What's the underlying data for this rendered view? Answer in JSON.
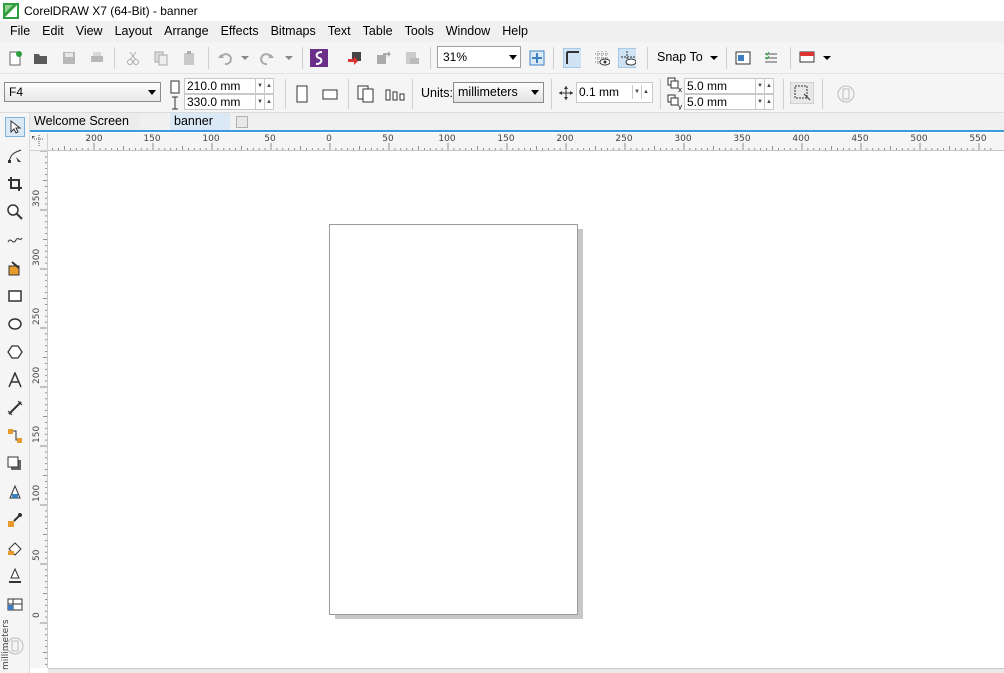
{
  "window": {
    "title": "CorelDRAW X7 (64-Bit) - banner"
  },
  "menu": [
    "File",
    "Edit",
    "View",
    "Layout",
    "Arrange",
    "Effects",
    "Bitmaps",
    "Text",
    "Table",
    "Tools",
    "Window",
    "Help"
  ],
  "toolbar": {
    "zoom_value": "31%",
    "snap_to_label": "Snap To"
  },
  "property_bar": {
    "page_size": "F4",
    "width": "210.0 mm",
    "height": "330.0 mm",
    "units_label": "Units:",
    "units_value": "millimeters",
    "nudge": "0.1 mm",
    "dup_x": "5.0 mm",
    "dup_y": "5.0 mm"
  },
  "tabs": {
    "welcome": "Welcome Screen",
    "document": "banner"
  },
  "rulers": {
    "horizontal_labels": [
      "200",
      "150",
      "100",
      "50",
      "0",
      "50",
      "100",
      "150",
      "200",
      "250",
      "300",
      "350",
      "400",
      "450",
      "500",
      "550"
    ],
    "vertical_labels": [
      "350",
      "300",
      "250",
      "200",
      "150",
      "100",
      "50",
      "0"
    ],
    "unit": "millimeters"
  },
  "colors": {
    "tab_accent": "#3c9ae0",
    "corel_green": "#2e9e3e",
    "corel_purple": "#6b2f8a"
  }
}
